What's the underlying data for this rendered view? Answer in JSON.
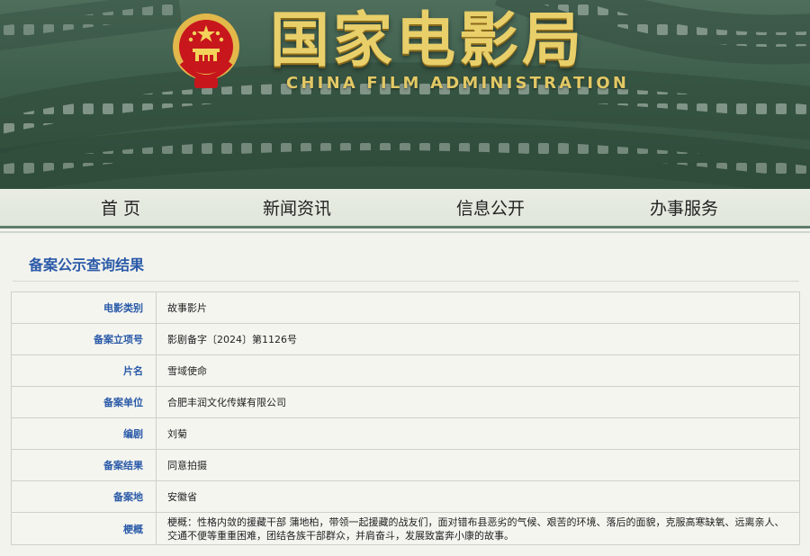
{
  "header": {
    "title_cn": "国家电影局",
    "title_en": "CHINA FILM ADMINISTRATION"
  },
  "nav": {
    "items": [
      "首 页",
      "新闻资讯",
      "信息公开",
      "办事服务"
    ]
  },
  "section": {
    "title": "备案公示查询结果"
  },
  "record": {
    "rows": [
      {
        "label": "电影类别",
        "value": "故事影片"
      },
      {
        "label": "备案立项号",
        "value": "影剧备字〔2024〕第1126号"
      },
      {
        "label": "片名",
        "value": "雪域使命"
      },
      {
        "label": "备案单位",
        "value": "合肥丰润文化传媒有限公司"
      },
      {
        "label": "编剧",
        "value": "刘菊"
      },
      {
        "label": "备案结果",
        "value": "同意拍摄"
      },
      {
        "label": "备案地",
        "value": "安徽省"
      },
      {
        "label": "梗概",
        "value": "梗概：性格内敛的援藏干部 蒲地柏，带领一起援藏的战友们，面对错布县恶劣的气候、艰苦的环境、落后的面貌，克服高寒缺氧、远离亲人、交通不便等重重困难，团结各族干部群众，并肩奋斗，发展致富奔小康的故事。"
      }
    ]
  },
  "colors": {
    "banner_green": "#3e5e4c",
    "gold": "#e8cf6a",
    "label_blue": "#2a5aa8",
    "emblem_red": "#c8161d"
  }
}
